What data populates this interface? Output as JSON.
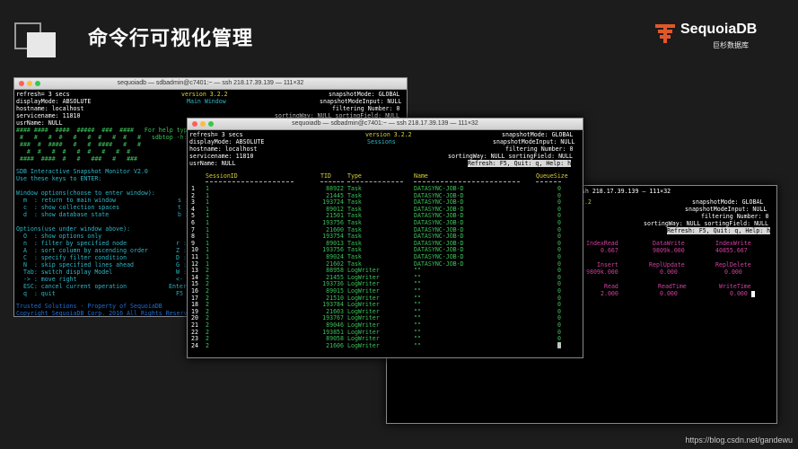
{
  "slide": {
    "title": "命令行可视化管理",
    "footer": "https://blog.csdn.net/gandewu"
  },
  "logo": {
    "name": "SequoiaDB",
    "subtitle": "巨杉数据库"
  },
  "colors": {
    "cyan": "#2fb6c6",
    "yellow": "#d8d03a",
    "green": "#3cc25a",
    "magenta": "#d33fa0"
  },
  "win1": {
    "title": "sequoiadb — sdbadmin@c7401:~ — ssh 218.17.39.139 — 111×32",
    "refresh": "refresh= 3 secs",
    "version": "version 3.2.2",
    "window": "Main Window",
    "snapshotMode": "snapshotMode: GLOBAL",
    "snapshotModeInput": "snapshotModeInput: NULL",
    "filtering": "filtering Number: 0",
    "sorting": "sortingWay: NULL sortingField: NULL",
    "displayMode": "displayMode: ABSOLUTE",
    "hostname": "hostname: localhost",
    "servicename": "servicename: 11810",
    "usrName": "usrName: NULL",
    "banner": [
      "#### ####  ####  #####  ###  ####   For help type",
      " #   #   #  #   #   #  #   #  #   #   sdbtop -h: or",
      " ###  #  ####   #   #  ####   #   #",
      "   #  #   #  #   #  #   #   #  #",
      " ####  ####  #   #   ###   #   ###"
    ],
    "monitor": "SDB Interactive Snapshot Monitor V2.0",
    "usekeys": "Use these keys to ENTER:",
    "section1": "Window options(choose to enter window):",
    "opts1": [
      "  m  : return to main window",
      "  c  : show collection spaces",
      "  d  : show database state"
    ],
    "opts1r": [
      "s : sho",
      "t : sho",
      "b : he"
    ],
    "section2": "Options(use under window above):",
    "opts2": [
      "  O  : show options only",
      "  n  : filter by specified node",
      "  A  : sort column by ascending order",
      "  C  : specify filter condition",
      "  N  : skip specified lines ahead",
      "  Tab: switch display Model",
      "  -> : move right",
      "  ESC: cancel current operation",
      "  q  : quit"
    ],
    "opts2r": [
      "r : se",
      "Z : se",
      "D : so",
      "G : co",
      "W : co",
      "<- : mo",
      "Enter: to",
      "F5 : re"
    ],
    "copyright1": "Trusted Solutions - Property of SequoiaDB",
    "copyright2": "Copyright SequoiaDB Corp. 2016 All Rights Reserved"
  },
  "win2": {
    "title": "sequoiadb — sdbadmin@c7401:~ — ssh 218.17.39.139 — 111×32",
    "refresh": "refresh= 3 secs",
    "version": "version 3.2.2",
    "window": "Sessions",
    "snapshotMode": "snapshotMode: GLOBAL",
    "snapshotModeInput": "snapshotModeInput: NULL",
    "filtering": "filtering Number: 0",
    "sorting": "sortingWay: NULL sortingField: NULL",
    "help": "Refresh: F5, Quit: q, Help: h",
    "displayMode": "displayMode: ABSOLUTE",
    "hostname": "hostname: localhost",
    "servicename": "servicename: 11810",
    "usrName": "usrName: NULL",
    "columns": [
      "SessionID",
      "TID",
      "Type",
      "Name",
      "QueueSize"
    ],
    "rows": [
      [
        "1",
        "1",
        "88922",
        "Task",
        "DATASYNC-JOB-D",
        "0"
      ],
      [
        "2",
        "1",
        "21445",
        "Task",
        "DATASYNC-JOB-D",
        "0"
      ],
      [
        "3",
        "1",
        "193724",
        "Task",
        "DATASYNC-JOB-D",
        "0"
      ],
      [
        "4",
        "1",
        "89012",
        "Task",
        "DATASYNC-JOB-D",
        "0"
      ],
      [
        "5",
        "1",
        "21501",
        "Task",
        "DATASYNC-JOB-D",
        "0"
      ],
      [
        "6",
        "1",
        "193756",
        "Task",
        "DATASYNC-JOB-D",
        "0"
      ],
      [
        "7",
        "1",
        "21600",
        "Task",
        "DATASYNC-JOB-D",
        "0"
      ],
      [
        "8",
        "1",
        "193754",
        "Task",
        "DATASYNC-JOB-D",
        "0"
      ],
      [
        "9",
        "1",
        "89013",
        "Task",
        "DATASYNC-JOB-D",
        "0"
      ],
      [
        "10",
        "1",
        "193756",
        "Task",
        "DATASYNC-JOB-D",
        "0"
      ],
      [
        "11",
        "1",
        "89024",
        "Task",
        "DATASYNC-JOB-D",
        "0"
      ],
      [
        "12",
        "1",
        "21602",
        "Task",
        "DATASYNC-JOB-D",
        "0"
      ],
      [
        "13",
        "2",
        "88958",
        "LogWriter",
        "\"\"",
        "0"
      ],
      [
        "14",
        "2",
        "21455",
        "LogWriter",
        "\"\"",
        "0"
      ],
      [
        "15",
        "2",
        "193736",
        "LogWriter",
        "\"\"",
        "0"
      ],
      [
        "16",
        "2",
        "89015",
        "LogWriter",
        "\"\"",
        "0"
      ],
      [
        "17",
        "2",
        "21510",
        "LogWriter",
        "\"\"",
        "0"
      ],
      [
        "18",
        "2",
        "193784",
        "LogWriter",
        "\"\"",
        "0"
      ],
      [
        "19",
        "2",
        "21603",
        "LogWriter",
        "\"\"",
        "0"
      ],
      [
        "20",
        "2",
        "193767",
        "LogWriter",
        "\"\"",
        "0"
      ],
      [
        "21",
        "2",
        "89046",
        "LogWriter",
        "\"\"",
        "0"
      ],
      [
        "22",
        "2",
        "193851",
        "LogWriter",
        "\"\"",
        "0"
      ],
      [
        "23",
        "2",
        "89058",
        "LogWriter",
        "\"\"",
        "0"
      ],
      [
        "24",
        "2",
        "21606",
        "LogWriter",
        "\"\"",
        "0"
      ]
    ]
  },
  "win3": {
    "title": "— ssh 218.17.39.139 — 111×32",
    "version": ".2.2",
    "snapshotMode": "snapshotMode: GLOBAL",
    "snapshotModeInput": "snapshotModeInput: NULL",
    "filtering": "filtering Number: 0",
    "sorting": "sortingWay: NULL sortingField: NULL",
    "help": "Refresh: F5, Quit: q, Help: h",
    "metrics": [
      {
        "label": "IndexRead",
        "value": "0.667"
      },
      {
        "label": "DataWrite",
        "value": "9809k.000"
      },
      {
        "label": "IndexWrite",
        "value": "40855.667"
      },
      {
        "label": "Insert",
        "value": "9809k.000"
      },
      {
        "label": "ReplUpdate",
        "value": "0.000"
      },
      {
        "label": "ReplDelete",
        "value": "0.000"
      },
      {
        "label": "Read",
        "value": "2.000"
      },
      {
        "label": "ReadTime",
        "value": "0.000"
      },
      {
        "label": "WriteTime",
        "value": "0.000"
      }
    ]
  }
}
